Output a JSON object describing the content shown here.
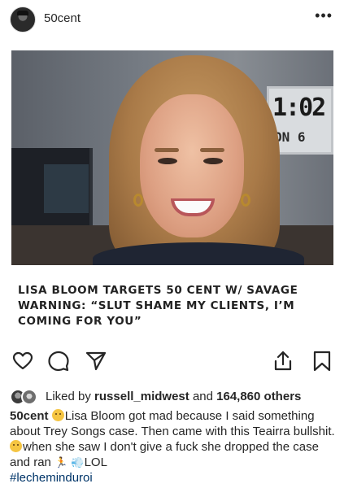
{
  "post": {
    "username": "50cent",
    "more_label": "•••",
    "headline": "LISA BLOOM TARGETS 50 CENT W/ SAVAGE WARNING: “SLUT SHAME MY CLIENTS, I’M COMING FOR YOU”",
    "photo_clock_time": "1:02",
    "photo_clock_date": "ON 6"
  },
  "actions": {
    "icons": [
      "heart-icon",
      "comment-icon",
      "share-icon",
      "upload-icon",
      "bookmark-icon"
    ]
  },
  "likes": {
    "prefix": "Liked by",
    "liker_name": "russell_midwest",
    "and_label": "and",
    "others_count": "164,860 others"
  },
  "caption": {
    "author": "50cent",
    "part1": "Lisa Bloom got mad because I said something about Trey Songs case. Then came with this Teairra bullshit.",
    "part2": "when she saw I don't give a fuck she dropped the case and ran",
    "part3": "LOL",
    "hashtag": "#lecheminduroi"
  }
}
